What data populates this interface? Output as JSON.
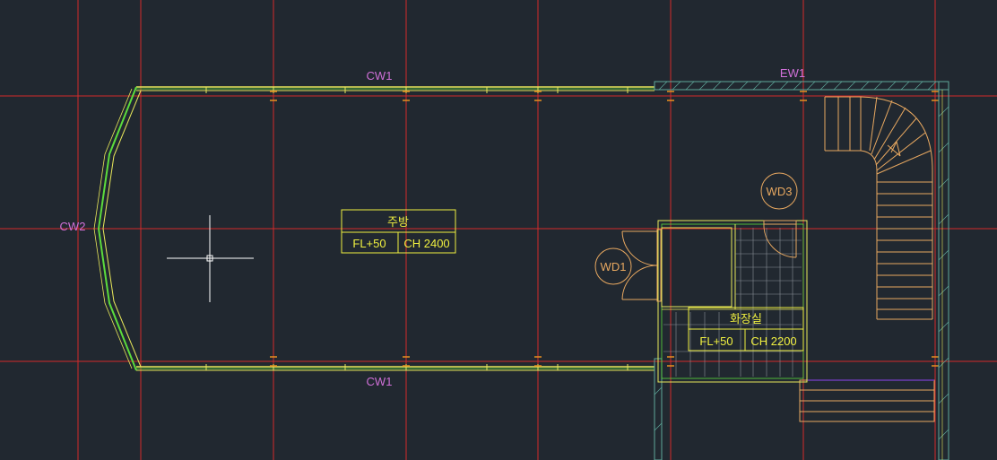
{
  "labels": {
    "cw1_top": "CW1",
    "cw1_bottom": "CW1",
    "cw2": "CW2",
    "ew1": "EW1",
    "wd1": "WD1",
    "wd3": "WD3"
  },
  "rooms": {
    "kitchen": {
      "name": "주방",
      "fl": "FL+50",
      "ch": "CH 2400"
    },
    "restroom": {
      "name": "화장실",
      "fl": "FL+50",
      "ch": "CH 2200"
    }
  },
  "colors": {
    "background": "#212830",
    "grid": "#d42a2a",
    "wall_yellow": "#e8e85a",
    "wall_green": "#5cdc3c",
    "ext_wall": "#5fa89a",
    "door": "#e8a860",
    "tag": "#d070d8",
    "room_tag": "#f0f040",
    "crosshair": "#ffffff"
  }
}
